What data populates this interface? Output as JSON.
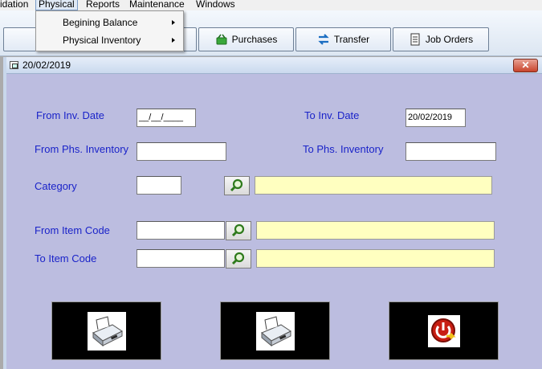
{
  "menubar": {
    "items": [
      "idation",
      "Physical",
      "Reports",
      "Maintenance",
      "Windows"
    ]
  },
  "dropdown": {
    "items": [
      "Begining Balance",
      "Physical Inventory"
    ]
  },
  "toolbar": {
    "buttons": [
      "Purchases",
      "Transfer",
      "Job Orders"
    ]
  },
  "window": {
    "title": "20/02/2019",
    "close_label": "✕"
  },
  "form": {
    "from_inv_date_label": "From Inv. Date",
    "from_inv_date_value": "__/__/____",
    "to_inv_date_label": "To Inv. Date",
    "to_inv_date_value": "20/02/2019",
    "from_phs_label": "From Phs. Inventory",
    "from_phs_value": "",
    "to_phs_label": "To Phs. Inventory",
    "to_phs_value": "",
    "category_label": "Category",
    "category_value": "",
    "from_item_label": "From Item Code",
    "from_item_value": "",
    "to_item_label": "To Item Code",
    "to_item_value": ""
  },
  "icons": {
    "lookup": "magnifier-icon",
    "preview": "printer-icon",
    "print": "printer-icon",
    "exit": "power-exit-icon"
  },
  "colors": {
    "form_bg": "#bcbde0",
    "label_text": "#1a23c9",
    "description_field": "#ffffc0"
  }
}
